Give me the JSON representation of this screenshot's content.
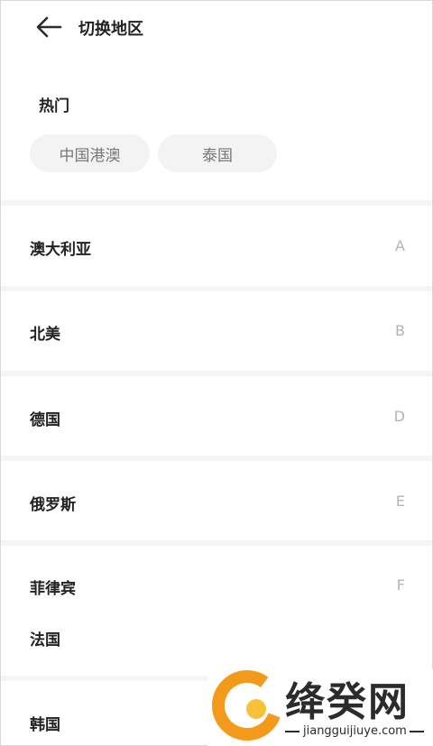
{
  "header": {
    "back_icon": "back-arrow-icon",
    "title": "切换地区"
  },
  "hot": {
    "title": "热门",
    "chips": [
      "中国港澳",
      "泰国"
    ]
  },
  "regions": [
    {
      "label": "澳大利亚",
      "letter": "A"
    },
    {
      "label": "北美",
      "letter": "B"
    },
    {
      "label": "德国",
      "letter": "D"
    },
    {
      "label": "俄罗斯",
      "letter": "E"
    },
    {
      "label": "菲律宾",
      "letter": "F"
    },
    {
      "label": "法国",
      "letter": ""
    },
    {
      "label": "韩国",
      "letter": ""
    }
  ],
  "watermark": {
    "logo_icon": "g-logo-icon",
    "text": "绛癸网",
    "url": "jiangguijiuye.com",
    "colors": {
      "orange": "#f39a1b",
      "yellow": "#f7c23a"
    }
  }
}
